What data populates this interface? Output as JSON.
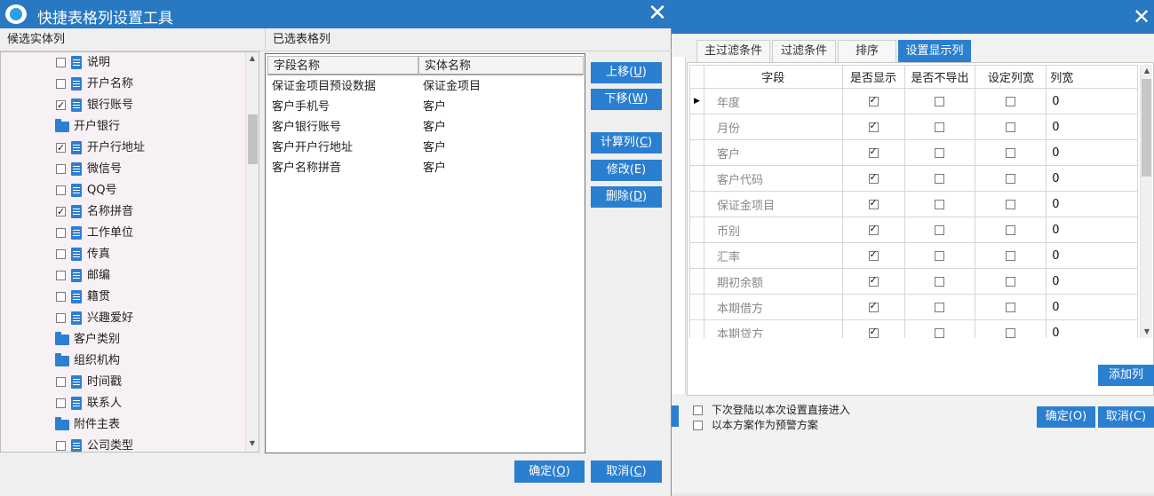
{
  "background_window": {
    "tabs": [
      "主过滤条件",
      "过滤条件",
      "排序",
      "设置显示列"
    ],
    "active_tab": "设置显示列",
    "columns": [
      "字段",
      "是否显示",
      "是否不导出",
      "设定列宽",
      "列宽"
    ],
    "rows": [
      {
        "field": "年度",
        "show": true,
        "no_export": false,
        "set_width": false,
        "width": "0"
      },
      {
        "field": "月份",
        "show": true,
        "no_export": false,
        "set_width": false,
        "width": "0"
      },
      {
        "field": "客户",
        "show": true,
        "no_export": false,
        "set_width": false,
        "width": "0"
      },
      {
        "field": "客户代码",
        "show": true,
        "no_export": false,
        "set_width": false,
        "width": "0"
      },
      {
        "field": "保证金项目",
        "show": true,
        "no_export": false,
        "set_width": false,
        "width": "0"
      },
      {
        "field": "币别",
        "show": true,
        "no_export": false,
        "set_width": false,
        "width": "0"
      },
      {
        "field": "汇率",
        "show": true,
        "no_export": false,
        "set_width": false,
        "width": "0"
      },
      {
        "field": "期初余额",
        "show": true,
        "no_export": false,
        "set_width": false,
        "width": "0"
      },
      {
        "field": "本期借方",
        "show": true,
        "no_export": false,
        "set_width": false,
        "width": "0"
      },
      {
        "field": "本期贷方",
        "show": true,
        "no_export": false,
        "set_width": false,
        "width": "0"
      }
    ],
    "add_column_label": "添加列",
    "option_auto_enter": "下次登陆以本次设置直接进入",
    "option_alert_plan": "以本方案作为预警方案",
    "ok_label": "确定(O)",
    "cancel_label": "取消(C)",
    "close_glyph": "✕"
  },
  "dialog": {
    "title": "快捷表格列设置工具",
    "close_glyph": "✕",
    "left_header": "候选实体列",
    "right_header": "已选表格列",
    "tree": [
      {
        "type": "doc",
        "label": "说明",
        "checked": false
      },
      {
        "type": "doc",
        "label": "开户名称",
        "checked": false
      },
      {
        "type": "doc",
        "label": "银行账号",
        "checked": true
      },
      {
        "type": "folder",
        "label": "开户银行"
      },
      {
        "type": "doc",
        "label": "开户行地址",
        "checked": true
      },
      {
        "type": "doc",
        "label": "微信号",
        "checked": false
      },
      {
        "type": "doc",
        "label": "QQ号",
        "checked": false
      },
      {
        "type": "doc",
        "label": "名称拼音",
        "checked": true
      },
      {
        "type": "doc",
        "label": "工作单位",
        "checked": false
      },
      {
        "type": "doc",
        "label": "传真",
        "checked": false
      },
      {
        "type": "doc",
        "label": "邮编",
        "checked": false
      },
      {
        "type": "doc",
        "label": "籍贯",
        "checked": false
      },
      {
        "type": "doc",
        "label": "兴趣爱好",
        "checked": false
      },
      {
        "type": "folder",
        "label": "客户类别"
      },
      {
        "type": "folder",
        "label": "组织机构"
      },
      {
        "type": "doc",
        "label": "时间戳",
        "checked": false
      },
      {
        "type": "doc",
        "label": "联系人",
        "checked": false
      },
      {
        "type": "folder",
        "label": "附件主表"
      },
      {
        "type": "doc",
        "label": "公司类型",
        "checked": false
      }
    ],
    "selected_columns_header": [
      "字段名称",
      "实体名称"
    ],
    "selected_rows": [
      {
        "field": "保证金项目预设数据",
        "entity": "保证金项目"
      },
      {
        "field": "客户手机号",
        "entity": "客户"
      },
      {
        "field": "客户银行账号",
        "entity": "客户"
      },
      {
        "field": "客户开户行地址",
        "entity": "客户"
      },
      {
        "field": "客户名称拼音",
        "entity": "客户"
      }
    ],
    "buttons": {
      "up": {
        "text": "上移(",
        "key": "U",
        "end": ")"
      },
      "down": {
        "text": "下移(",
        "key": "W",
        "end": ")"
      },
      "calc": {
        "text": "计算列(",
        "key": "C",
        "end": ")"
      },
      "edit": {
        "text": "修改(E)"
      },
      "delete": {
        "text": "删除(",
        "key": "D",
        "end": ")"
      },
      "ok": {
        "text": "确定(",
        "key": "O",
        "end": ")"
      },
      "cancel": {
        "text": "取消(",
        "key": "C",
        "end": ")"
      }
    }
  }
}
